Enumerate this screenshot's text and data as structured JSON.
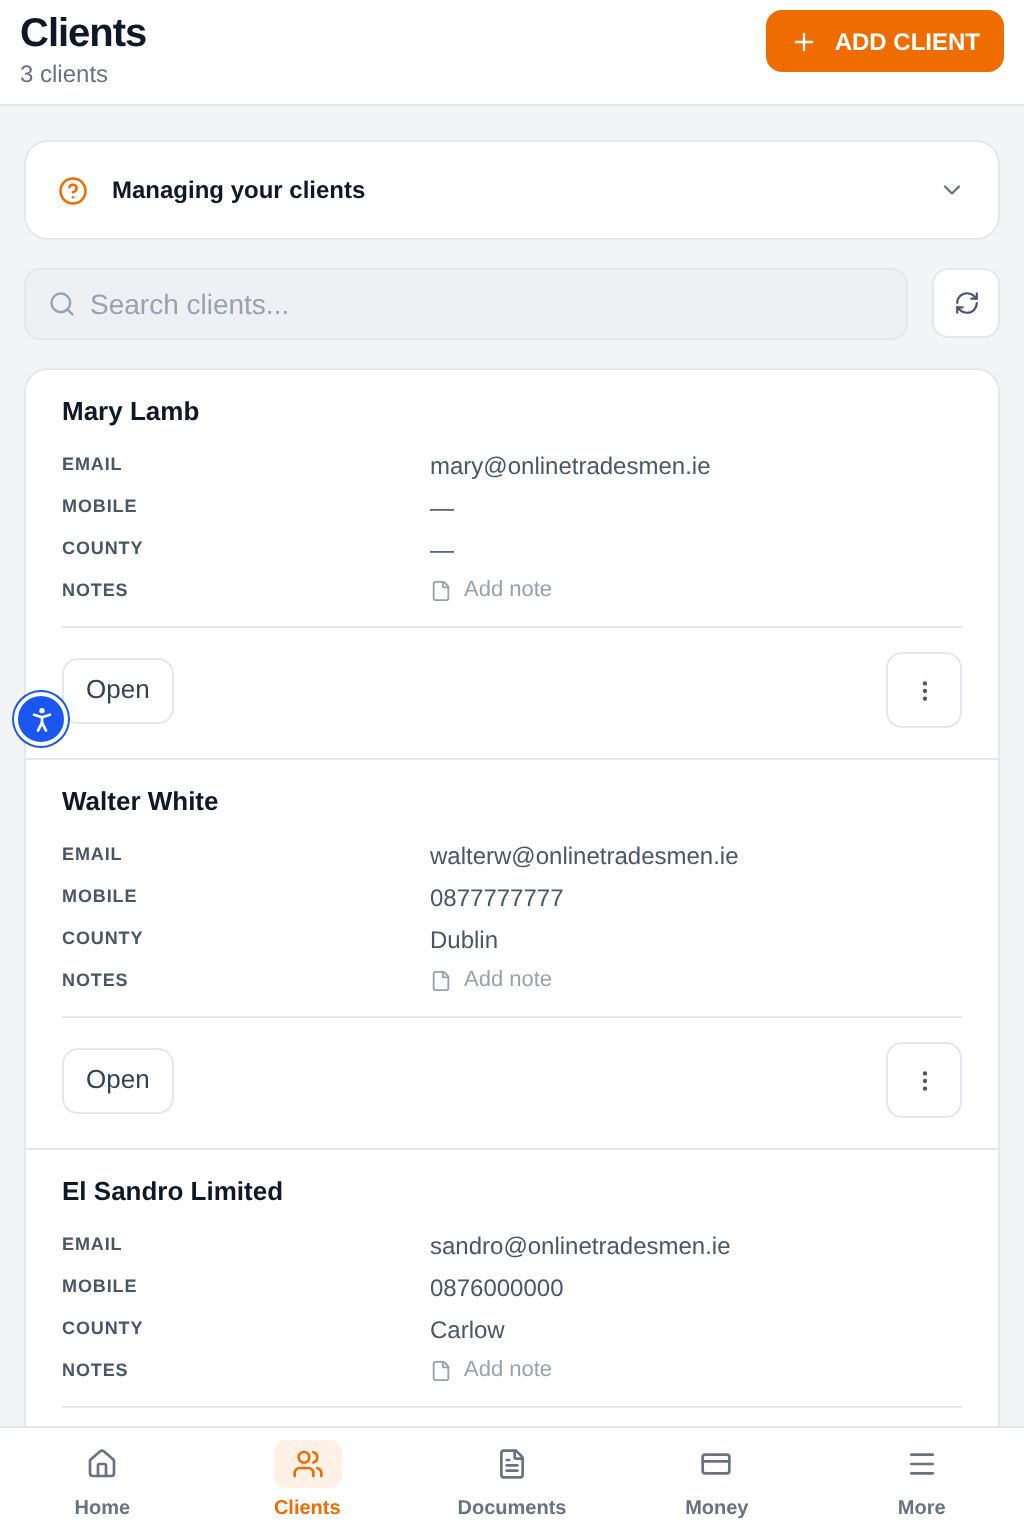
{
  "header": {
    "title": "Clients",
    "subtitle": "3 clients",
    "add_button": "ADD CLIENT"
  },
  "help": {
    "title": "Managing your clients",
    "expanded": false
  },
  "search": {
    "placeholder": "Search clients..."
  },
  "clients": [
    {
      "name": "Mary Lamb",
      "fields": [
        {
          "kind": "text",
          "label": "EMAIL",
          "value": "mary@onlinetradesmen.ie"
        },
        {
          "kind": "text",
          "label": "MOBILE",
          "value": "—"
        },
        {
          "kind": "text",
          "label": "COUNTY",
          "value": "—"
        },
        {
          "kind": "note",
          "label": "NOTES",
          "value": "Add note"
        }
      ],
      "open_label": "Open"
    },
    {
      "name": "Walter White",
      "fields": [
        {
          "kind": "text",
          "label": "EMAIL",
          "value": "walterw@onlinetradesmen.ie"
        },
        {
          "kind": "text",
          "label": "MOBILE",
          "value": "0877777777"
        },
        {
          "kind": "text",
          "label": "COUNTY",
          "value": "Dublin"
        },
        {
          "kind": "note",
          "label": "NOTES",
          "value": "Add note"
        }
      ],
      "open_label": "Open"
    },
    {
      "name": "El Sandro Limited",
      "fields": [
        {
          "kind": "text",
          "label": "EMAIL",
          "value": "sandro@onlinetradesmen.ie"
        },
        {
          "kind": "text",
          "label": "MOBILE",
          "value": "0876000000"
        },
        {
          "kind": "text",
          "label": "COUNTY",
          "value": "Carlow"
        },
        {
          "kind": "note",
          "label": "NOTES",
          "value": "Add note"
        }
      ]
    }
  ],
  "nav": [
    {
      "kind": "home",
      "label": "Home",
      "selected": false
    },
    {
      "kind": "clients",
      "label": "Clients",
      "selected": true
    },
    {
      "kind": "documents",
      "label": "Documents",
      "selected": false
    },
    {
      "kind": "money",
      "label": "Money",
      "selected": false
    },
    {
      "kind": "more",
      "label": "More",
      "selected": false
    }
  ]
}
